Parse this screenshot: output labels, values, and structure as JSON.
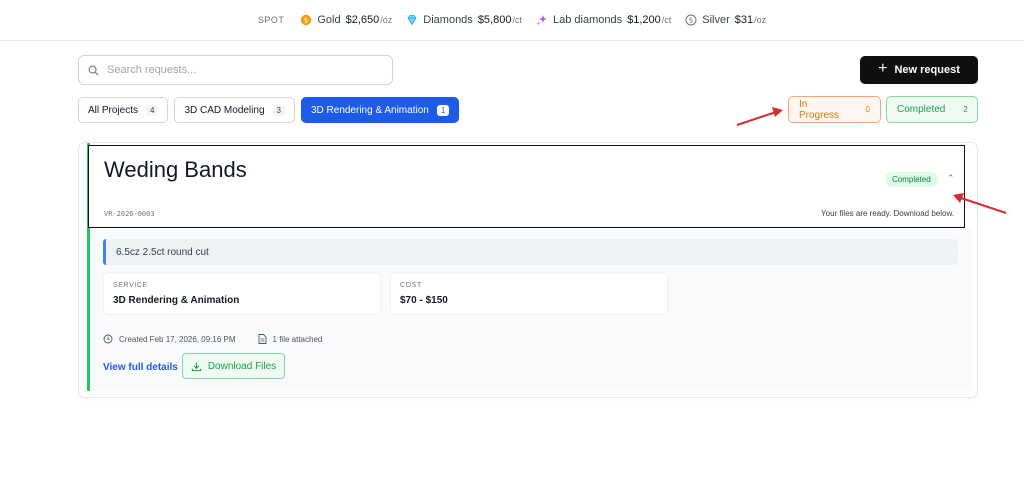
{
  "ticker": {
    "spot_label": "SPOT",
    "items": [
      {
        "name": "Gold",
        "price": "$2,650",
        "unit": "/oz",
        "icon": "gold-coin-icon",
        "color": "#f59e0b"
      },
      {
        "name": "Diamonds",
        "price": "$5,800",
        "unit": "/ct",
        "icon": "diamond-icon",
        "color": "#0ea5e9"
      },
      {
        "name": "Lab diamonds",
        "price": "$1,200",
        "unit": "/ct",
        "icon": "sparkle-icon",
        "color": "#a855f7"
      },
      {
        "name": "Silver",
        "price": "$31",
        "unit": "/oz",
        "icon": "silver-coin-icon",
        "color": "#6b7280"
      }
    ]
  },
  "search": {
    "placeholder": "Search requests..."
  },
  "new_request_label": "New request",
  "tabs": [
    {
      "label": "All Projects",
      "count": "4",
      "active": false
    },
    {
      "label": "3D CAD Modeling",
      "count": "3",
      "active": false
    },
    {
      "label": "3D Rendering & Animation",
      "count": "1",
      "active": true
    }
  ],
  "status_tabs": [
    {
      "label": "In Progress",
      "count": "0",
      "color": "#d97706"
    },
    {
      "label": "Completed",
      "count": "2",
      "color": "#16a34a"
    }
  ],
  "request": {
    "title": "Weding Bands",
    "status": "Completed",
    "ref_id": "VR-2026-0003",
    "ready_message": "Your files are ready. Download below.",
    "note": "6.5cz 2.5ct round cut",
    "service_label": "SERVICE",
    "service_value": "3D Rendering & Animation",
    "cost_label": "COST",
    "cost_value": "$70 - $150",
    "created": "Created Feb 17, 2026, 09:16 PM",
    "attachments": "1 file attached",
    "view_details_label": "View full details",
    "download_label": "Download Files"
  },
  "colors": {
    "accent_blue": "#1d5be8",
    "success_green": "#22c55e",
    "annotation_red": "#d32f2f"
  }
}
